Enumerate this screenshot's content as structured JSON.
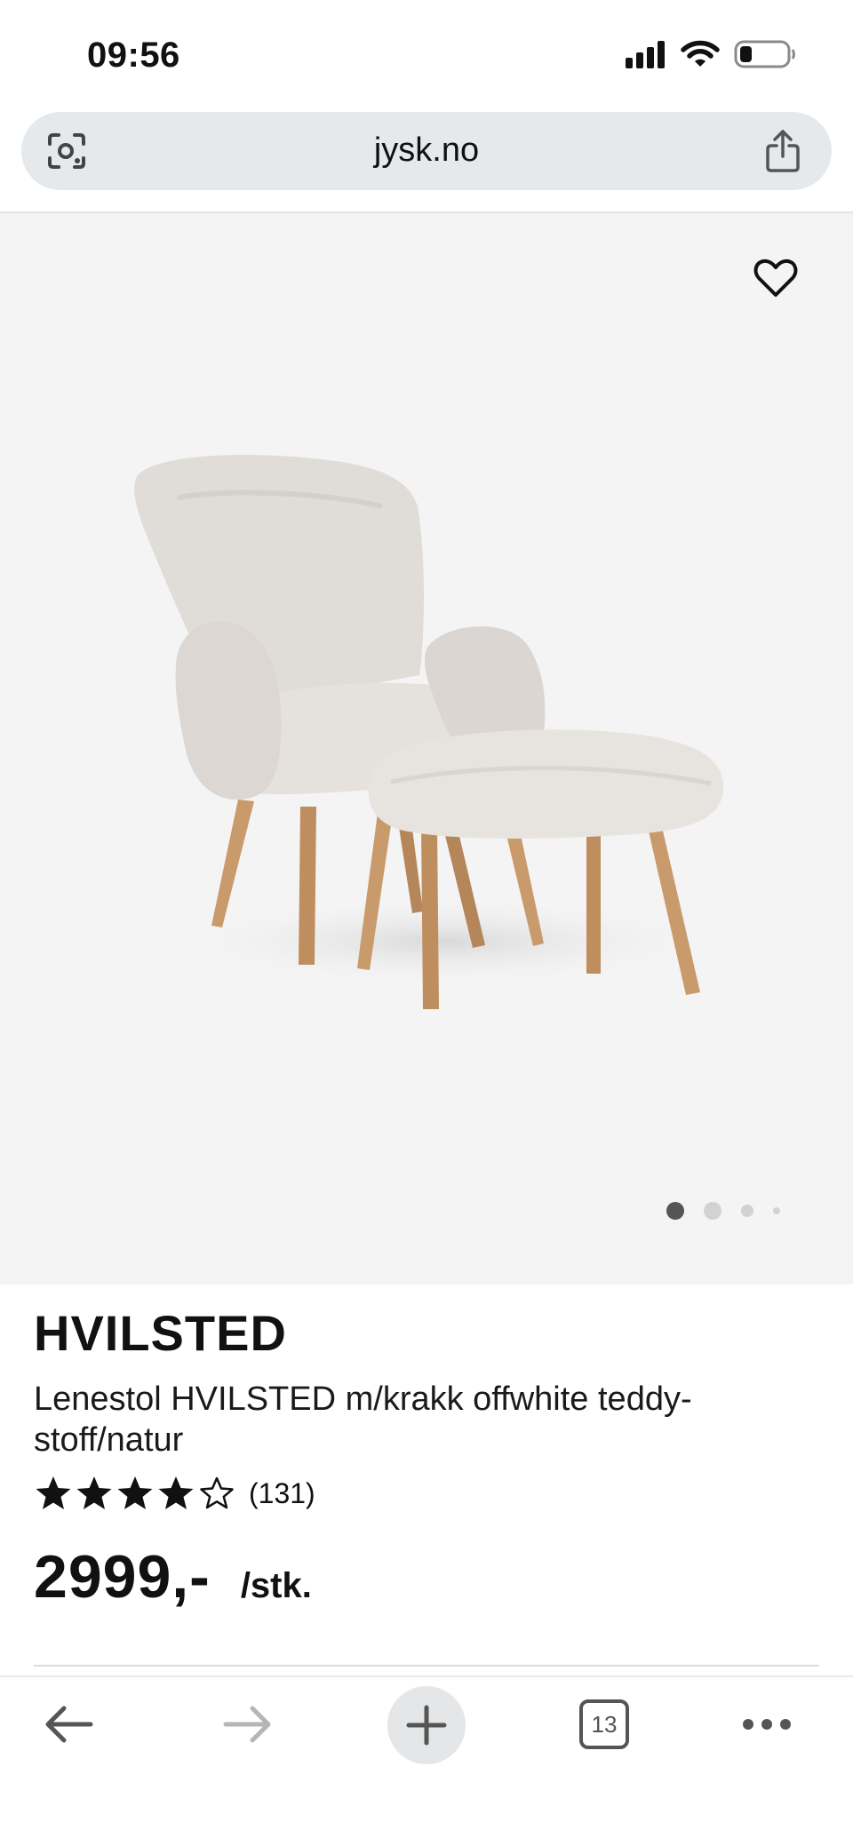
{
  "status_bar": {
    "time": "09:56"
  },
  "browser": {
    "url": "jysk.no",
    "tabs_count": "13"
  },
  "product": {
    "brand_title": "HVILSTED",
    "description": "Lenestol HVILSTED m/krakk offwhite teddy-stoff/natur",
    "rating": {
      "value": 4.5,
      "max": 5,
      "review_count": "(131)"
    },
    "price": "2999,-",
    "unit": "/stk."
  },
  "carousel": {
    "count": 4,
    "active_index": 0
  },
  "icons": {
    "lens": "camera-search-icon",
    "share": "share-icon",
    "favorite": "heart-outline-icon",
    "back": "arrow-left-icon",
    "forward": "arrow-right-icon",
    "new_tab": "plus-icon",
    "more": "more-dots-icon"
  },
  "colors": {
    "image_bg": "#f4f4f4",
    "star": "#111111",
    "wood": "#c99a6b",
    "fur": "#dedad6"
  }
}
